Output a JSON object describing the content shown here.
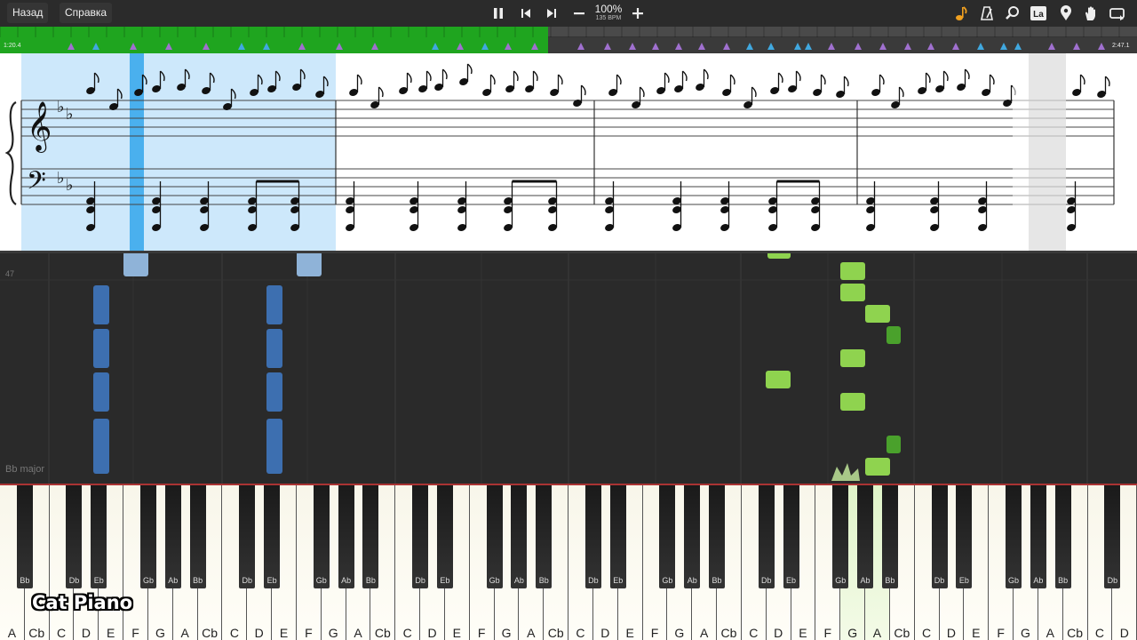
{
  "toolbar": {
    "back_label": "Назад",
    "help_label": "Справка",
    "zoom": "100%",
    "bpm": "135 BPM",
    "accent": "#f0a020",
    "icons": [
      "pause-icon",
      "skip-back-icon",
      "skip-forward-icon",
      "minus-icon",
      "plus-icon",
      "note-icon",
      "metronome-icon",
      "magnifier-icon",
      "note-names-icon",
      "location-pin-icon",
      "hand-icon",
      "loop-icon"
    ],
    "note_names_label": "La"
  },
  "timeline": {
    "elapsed": "1:20.4",
    "total": "2:47.1",
    "progress": 0.482,
    "progress_color": "#1fa51f",
    "marker_colors": {
      "purple": "#a070d0",
      "blue": "#40a8e0"
    }
  },
  "score": {
    "key_signature": "Bb major (2 flats)",
    "selection_color": "#cde8fb",
    "cursor_color": "#4ab0ee"
  },
  "piano_roll": {
    "row_label": "47",
    "key_label": "Bb major",
    "left_hand_color": "#3d6fb0",
    "right_hand_color": "#8fd34f"
  },
  "keyboard": {
    "white_keys": [
      "A",
      "Cb",
      "C",
      "D",
      "E",
      "F",
      "G",
      "A",
      "Cb",
      "C",
      "D",
      "E",
      "F",
      "G",
      "A",
      "Cb",
      "C",
      "D",
      "E",
      "F",
      "G",
      "A",
      "Cb",
      "C",
      "D",
      "E",
      "F",
      "G",
      "A",
      "Cb",
      "C",
      "D",
      "E",
      "F",
      "G",
      "A",
      "Cb",
      "C",
      "D",
      "E",
      "F",
      "G",
      "A",
      "Cb",
      "C",
      "D"
    ],
    "black_keys": [
      "Bb",
      "Db",
      "Eb",
      "Gb",
      "Ab",
      "Bb",
      "Db",
      "Eb",
      "Gb",
      "Ab",
      "Bb",
      "Db",
      "Eb",
      "Gb",
      "Ab",
      "Bb",
      "Db",
      "Eb",
      "Gb",
      "Ab",
      "Bb",
      "Db",
      "Eb",
      "Gb",
      "Ab",
      "Bb",
      "Db",
      "Eb",
      "Gb",
      "Ab",
      "Bb",
      "Db"
    ]
  },
  "watermark": "Cat Piano"
}
